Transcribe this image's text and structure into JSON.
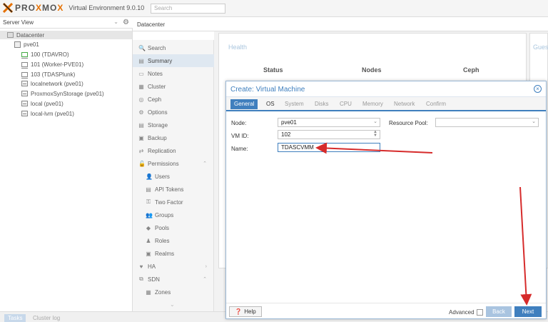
{
  "header": {
    "brand_prefix": "PRO",
    "brand_x": "X",
    "brand_mid": "MO",
    "brand_suffix": "X",
    "version_label": "Virtual Environment 9.0.10",
    "search_placeholder": "Search"
  },
  "left": {
    "view_select": "Server View",
    "tree": [
      {
        "label": "Datacenter",
        "icon": "datacenter-icon"
      },
      {
        "label": "pve01",
        "icon": "server-icon"
      },
      {
        "label": "100 (TDAVRO)",
        "icon": "vm-running-icon"
      },
      {
        "label": "101 (Worker-PVE01)",
        "icon": "vm-icon"
      },
      {
        "label": "103 (TDASPlunk)",
        "icon": "vm-icon"
      },
      {
        "label": "localnetwork (pve01)",
        "icon": "network-icon"
      },
      {
        "label": "ProxmoxSynStorage (pve01)",
        "icon": "storage-icon"
      },
      {
        "label": "local (pve01)",
        "icon": "storage-icon"
      },
      {
        "label": "local-lvm (pve01)",
        "icon": "storage-icon"
      }
    ]
  },
  "breadcrumb": "Datacenter",
  "submenu": [
    {
      "label": "Search",
      "icon": "🔍"
    },
    {
      "label": "Summary",
      "icon": "▤"
    },
    {
      "label": "Notes",
      "icon": "▭"
    },
    {
      "label": "Cluster",
      "icon": "▦"
    },
    {
      "label": "Ceph",
      "icon": "◎"
    },
    {
      "label": "Options",
      "icon": "⚙"
    },
    {
      "label": "Storage",
      "icon": "▤"
    },
    {
      "label": "Backup",
      "icon": "▣"
    },
    {
      "label": "Replication",
      "icon": "⇄"
    },
    {
      "label": "Permissions",
      "icon": "🔓"
    },
    {
      "label": "Users",
      "icon": "👤"
    },
    {
      "label": "API Tokens",
      "icon": "▤"
    },
    {
      "label": "Two Factor",
      "icon": "⚿"
    },
    {
      "label": "Groups",
      "icon": "👥"
    },
    {
      "label": "Pools",
      "icon": "◆"
    },
    {
      "label": "Roles",
      "icon": "♟"
    },
    {
      "label": "Realms",
      "icon": "▣"
    },
    {
      "label": "HA",
      "icon": "♥"
    },
    {
      "label": "SDN",
      "icon": "⧉"
    },
    {
      "label": "Zones",
      "icon": "▦"
    }
  ],
  "summary": {
    "health_title": "Health",
    "guests_title": "Gues",
    "col_status": "Status",
    "col_nodes": "Nodes",
    "col_ceph": "Ceph"
  },
  "bottom": {
    "tab_tasks": "Tasks",
    "tab_cluster_log": "Cluster log"
  },
  "dialog": {
    "title": "Create: Virtual Machine",
    "tabs": [
      "General",
      "OS",
      "System",
      "Disks",
      "CPU",
      "Memory",
      "Network",
      "Confirm"
    ],
    "node_label": "Node:",
    "node_value": "pve01",
    "vmid_label": "VM ID:",
    "vmid_value": "102",
    "name_label": "Name:",
    "name_value": "TDASCVMM",
    "pool_label": "Resource Pool:",
    "pool_value": "",
    "help_label": "Help",
    "advanced_label": "Advanced",
    "back_label": "Back",
    "next_label": "Next"
  },
  "colors": {
    "accent": "#3f7fbe",
    "annotation_arrow": "#d62b2b",
    "brand_orange": "#e57000"
  }
}
